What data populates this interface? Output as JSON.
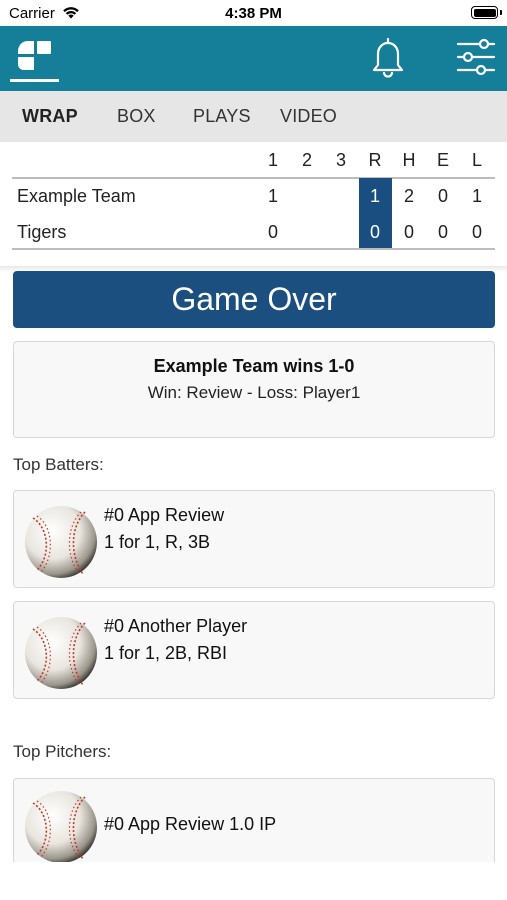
{
  "status_bar": {
    "carrier": "Carrier",
    "time": "4:38 PM"
  },
  "header": {
    "logo_icon": "app-logo-icon",
    "notification_icon": "bell-icon",
    "settings_icon": "sliders-icon",
    "background_color": "#157f9a"
  },
  "tabs": [
    {
      "label": "WRAP",
      "active": true
    },
    {
      "label": "BOX",
      "active": false
    },
    {
      "label": "PLAYS",
      "active": false
    },
    {
      "label": "VIDEO",
      "active": false
    }
  ],
  "linescore": {
    "headers": [
      "1",
      "2",
      "3",
      "R",
      "H",
      "E",
      "L"
    ],
    "teams": [
      {
        "name": "Example Team",
        "innings": [
          "1",
          "",
          ""
        ],
        "R": "1",
        "H": "2",
        "E": "0",
        "L": "1"
      },
      {
        "name": "Tigers",
        "innings": [
          "0",
          "",
          ""
        ],
        "R": "0",
        "H": "0",
        "E": "0",
        "L": "0"
      }
    ],
    "highlight_color": "#1b4e80"
  },
  "game_status": "Game Over",
  "result": {
    "headline": "Example Team wins 1-0",
    "decision": "Win: Review - Loss: Player1"
  },
  "top_batters": {
    "label": "Top Batters:",
    "players": [
      {
        "name": "#0 App Review",
        "line": "1 for 1, R, 3B",
        "icon": "baseball-icon"
      },
      {
        "name": "#0 Another Player",
        "line": "1 for 1, 2B, RBI",
        "icon": "baseball-icon"
      }
    ]
  },
  "top_pitchers": {
    "label": "Top Pitchers:",
    "players": [
      {
        "name": "#0 App Review 1.0 IP",
        "icon": "baseball-icon"
      }
    ]
  },
  "colors": {
    "accent": "#157f9a",
    "navy": "#1b4f80"
  }
}
